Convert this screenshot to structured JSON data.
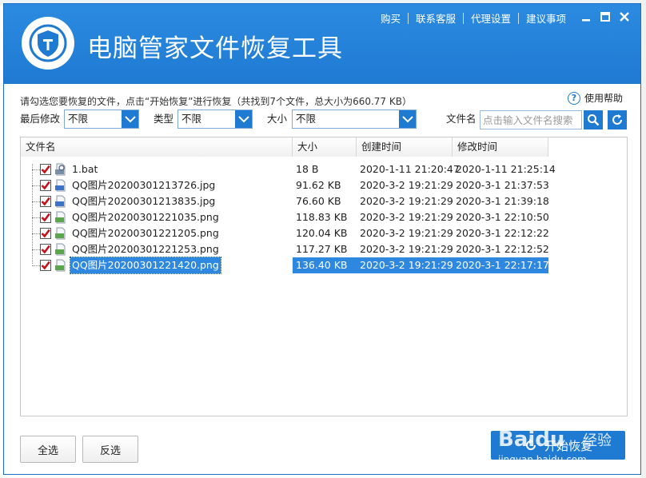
{
  "app": {
    "title": "电脑管家文件恢复工具"
  },
  "top_menu": [
    "购买",
    "联系客服",
    "代理设置",
    "建议事项"
  ],
  "info": {
    "summary": "请勾选您要恢复的文件，点击“开始恢复”进行恢复（共找到7个文件，总大小为660.77 KB）",
    "help_label": "使用帮助"
  },
  "filters": {
    "modified_label": "最后修改",
    "modified_value": "不限",
    "type_label": "类型",
    "type_value": "不限",
    "size_label": "大小",
    "size_value": "不限",
    "name_label": "文件名",
    "name_placeholder": "点击输入文件名搜索"
  },
  "table": {
    "columns": [
      "文件名",
      "大小",
      "创建时间",
      "修改时间"
    ],
    "rows": [
      {
        "name": "1.bat",
        "size": "18 B",
        "created": "2020-1-11 21:20:47",
        "modified": "2020-1-11 21:25:14",
        "kind": "bat",
        "checked": true,
        "selected": false
      },
      {
        "name": "QQ图片20200301213726.jpg",
        "size": "91.62 KB",
        "created": "2020-3-2 19:21:29",
        "modified": "2020-3-1 21:37:53",
        "kind": "jpg",
        "checked": true,
        "selected": false
      },
      {
        "name": "QQ图片20200301213835.jpg",
        "size": "76.60 KB",
        "created": "2020-3-2 19:21:29",
        "modified": "2020-3-1 21:39:18",
        "kind": "jpg",
        "checked": true,
        "selected": false
      },
      {
        "name": "QQ图片20200301221035.png",
        "size": "118.83 KB",
        "created": "2020-3-2 19:21:29",
        "modified": "2020-3-1 22:10:50",
        "kind": "png",
        "checked": true,
        "selected": false
      },
      {
        "name": "QQ图片20200301221205.png",
        "size": "120.04 KB",
        "created": "2020-3-2 19:21:29",
        "modified": "2020-3-1 22:12:22",
        "kind": "png",
        "checked": true,
        "selected": false
      },
      {
        "name": "QQ图片20200301221253.png",
        "size": "117.27 KB",
        "created": "2020-3-2 19:21:29",
        "modified": "2020-3-1 22:12:52",
        "kind": "png",
        "checked": true,
        "selected": false
      },
      {
        "name": "QQ图片20200301221420.png",
        "size": "136.40 KB",
        "created": "2020-3-2 19:21:29",
        "modified": "2020-3-1 22:17:17",
        "kind": "png",
        "checked": true,
        "selected": true
      }
    ]
  },
  "buttons": {
    "select_all": "全选",
    "invert": "反选",
    "start": "开始恢复"
  },
  "watermark": {
    "brand": "Baidu",
    "brand_cn": "经验",
    "url": "jingyan.baidu.com"
  },
  "colors": {
    "accent": "#1f7ad2",
    "selection": "#2e88e0",
    "check": "#c4121c"
  }
}
